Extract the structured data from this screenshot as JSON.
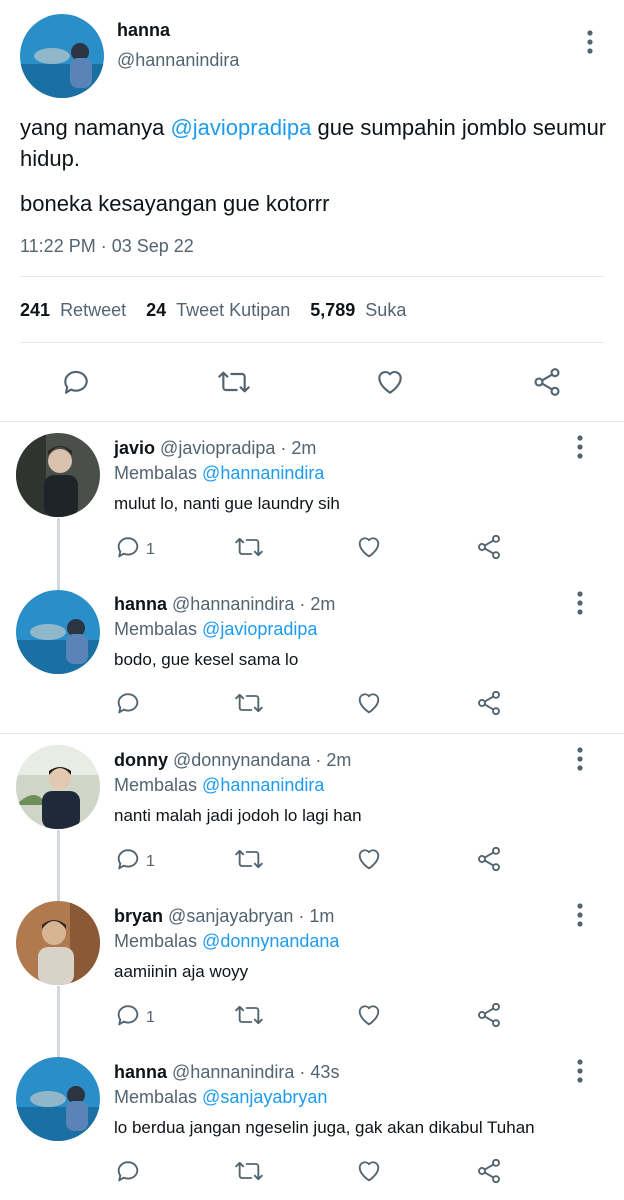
{
  "main_tweet": {
    "name": "hanna",
    "handle": "@hannanindira",
    "text_prefix": "yang namanya ",
    "mention": "@javiopradipa",
    "text_suffix": " gue sumpahin jomblo seumur hidup.",
    "text_line2": "boneka kesayangan gue kotorrr",
    "timestamp": "11:22 PM · 03 Sep 22",
    "stats": {
      "retweets_count": "241",
      "retweets_label": "Retweet",
      "quotes_count": "24",
      "quotes_label": "Tweet Kutipan",
      "likes_count": "5,789",
      "likes_label": "Suka"
    }
  },
  "replies": [
    {
      "name": "javio",
      "handle": "@javiopradipa",
      "time": "· 2m",
      "replying_label": "Membalas",
      "replying_to": "@hannanindira",
      "text": "mulut lo, nanti gue laundry sih",
      "reply_count": "1"
    },
    {
      "name": "hanna",
      "handle": "@hannanindira",
      "time": "· 2m",
      "replying_label": "Membalas",
      "replying_to": "@javiopradipa",
      "text": "bodo, gue kesel sama lo",
      "reply_count": ""
    },
    {
      "name": "donny",
      "handle": "@donnynandana",
      "time": "· 2m",
      "replying_label": "Membalas",
      "replying_to": "@hannanindira",
      "text": "nanti malah jadi jodoh lo lagi han",
      "reply_count": "1"
    },
    {
      "name": "bryan",
      "handle": "@sanjayabryan",
      "time": "· 1m",
      "replying_label": "Membalas",
      "replying_to": "@donnynandana",
      "text": "aamiinin aja woyy",
      "reply_count": "1"
    },
    {
      "name": "hanna",
      "handle": "@hannanindira",
      "time": "· 43s",
      "replying_label": "Membalas",
      "replying_to": "@sanjayabryan",
      "text": "lo berdua jangan ngeselin juga, gak akan dikabul Tuhan",
      "reply_count": ""
    }
  ],
  "icons": {
    "reply": "reply-icon",
    "retweet": "retweet-icon",
    "like": "heart-icon",
    "share": "share-icon",
    "more": "more-vertical-icon"
  },
  "colors": {
    "link": "#1d9bf0",
    "muted": "#536471",
    "text": "#0f1419",
    "divider": "#e6e9eb"
  }
}
